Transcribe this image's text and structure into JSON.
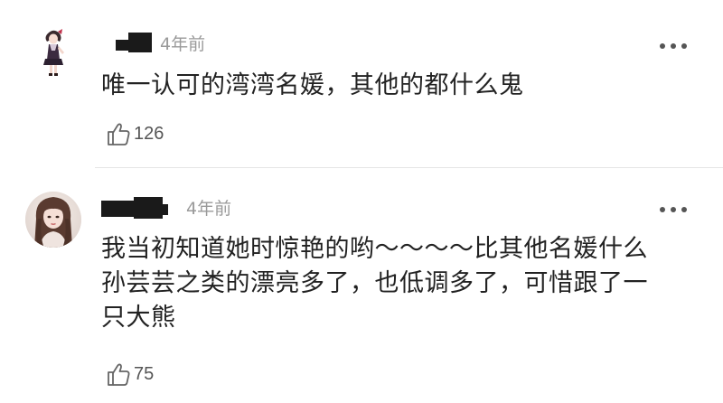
{
  "comments": [
    {
      "timestamp": "4年前",
      "lines": [
        "唯一认可的湾湾名媛，其他的都什么鬼"
      ],
      "likes": "126",
      "avatar_icon": "anime-girl-avatar",
      "more_icon": "more-dots-icon"
    },
    {
      "timestamp": "4年前",
      "lines": [
        "我当初知道她时惊艳的哟～～～～比其他名媛什么",
        "孙芸芸之类的漂亮多了，也低调多了，可惜跟了一",
        "只大熊"
      ],
      "likes": "75",
      "avatar_icon": "girl-photo-avatar",
      "more_icon": "more-dots-icon"
    }
  ],
  "colors": {
    "text": "#222222",
    "meta": "#9a9a9a",
    "icon": "#555555",
    "divider": "#e6e6e6"
  }
}
